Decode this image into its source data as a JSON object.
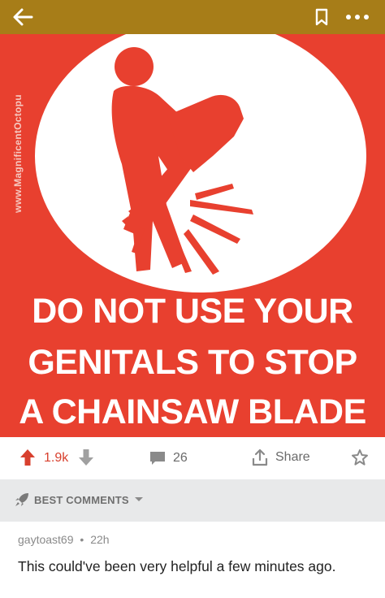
{
  "topbar": {
    "background": "#a77d18",
    "icons": [
      "back-arrow-icon",
      "bookmark-icon",
      "more-icon"
    ]
  },
  "post": {
    "watermark": "www.MagnificentOctopu",
    "sign_lines": [
      "DO NOT USE YOUR",
      "GENITALS TO STOP",
      "A CHAINSAW BLADE"
    ],
    "sign_color": "#e8402f"
  },
  "actions": {
    "score": "1.9k",
    "comments": "26",
    "share_label": "Share",
    "score_color": "#d8402e"
  },
  "sort": {
    "label": "BEST COMMENTS"
  },
  "comment": {
    "author": "gaytoast69",
    "separator": "•",
    "age": "22h",
    "body": "This could've been very helpful a few minutes ago."
  }
}
